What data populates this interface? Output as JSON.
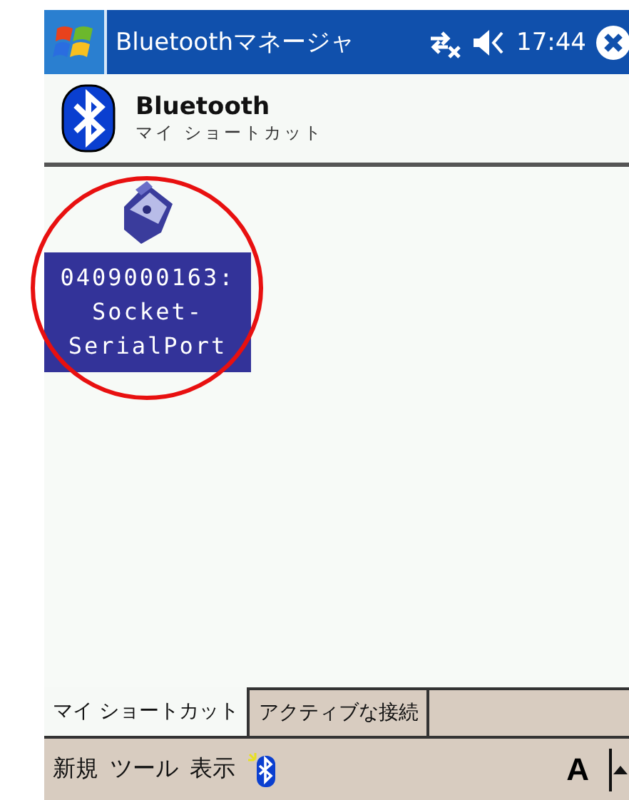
{
  "title_bar": {
    "title": "Bluetoothマネージャ",
    "time": "17:44"
  },
  "header": {
    "title": "Bluetooth",
    "subtitle": "マイ ショートカット"
  },
  "shortcuts": [
    {
      "label": "0409000163: Socket-SerialPort",
      "selected": true,
      "circled": true
    }
  ],
  "tabs": [
    {
      "label": "マイ ショートカット",
      "selected": true
    },
    {
      "label": "アクティブな接続",
      "selected": false
    }
  ],
  "menu": [
    "新規",
    "ツール",
    "表示"
  ],
  "input_button": "A"
}
